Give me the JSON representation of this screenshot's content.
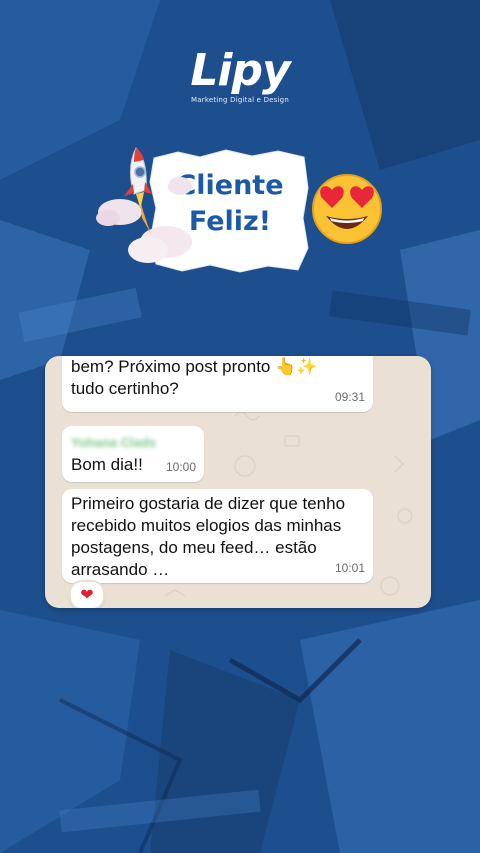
{
  "brand": {
    "logo_text": "Lipy",
    "tagline": "Marketing Digital e Design"
  },
  "header": {
    "title_line1": "Cliente",
    "title_line2": "Feliz!",
    "rocket_icon": "rocket-icon",
    "emoji_icon": "heart-eyes-emoji-icon"
  },
  "chat": {
    "messages": [
      {
        "line1": "bem? Próximo post pronto",
        "line1_emoji": "👆✨",
        "line2": "tudo certinho?",
        "time": "09:31"
      },
      {
        "sender": "Yohana Clads",
        "text": "Bom dia!!",
        "time": "10:00"
      },
      {
        "line1": "Primeiro gostaria de dizer que tenho",
        "line2": "recebido muitos elogios das minhas",
        "line3": "postagens, do meu feed… estão",
        "line4": "arrasando …",
        "time": "10:01",
        "reaction": "❤"
      }
    ]
  },
  "colors": {
    "background": "#1d4f8f",
    "title": "#1c5aa6",
    "chat_bg": "#eae0d3",
    "bubble": "#ffffff"
  }
}
